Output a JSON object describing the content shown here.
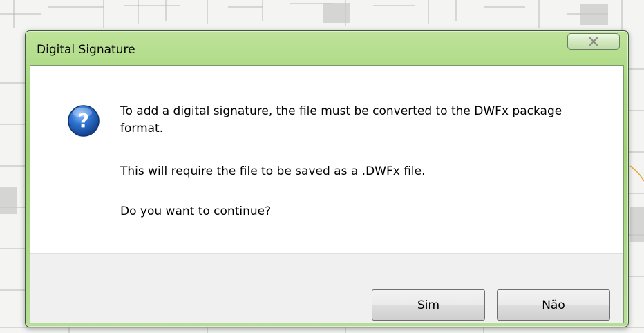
{
  "dialog": {
    "title": "Digital Signature",
    "message_line1": "To add a digital signature, the file must be converted to the DWFx package format.",
    "message_line2": "This will require the file to be saved as a .DWFx file.",
    "message_line3": "Do you want to continue?",
    "icon": "question-icon",
    "buttons": {
      "yes": "Sim",
      "no": "Não"
    }
  },
  "colors": {
    "frame_green": "#a8d77e",
    "footer_gray": "#f0f0f0",
    "icon_blue": "#1f5fb7"
  }
}
